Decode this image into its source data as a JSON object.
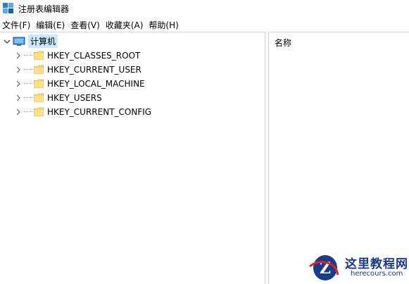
{
  "window": {
    "title": "注册表编辑器",
    "icon": "registry-editor-icon"
  },
  "menu": [
    {
      "label": "文件(F)"
    },
    {
      "label": "编辑(E)"
    },
    {
      "label": "查看(V)"
    },
    {
      "label": "收藏夹(A)"
    },
    {
      "label": "帮助(H)"
    }
  ],
  "tree": {
    "root": {
      "label": "计算机",
      "icon": "computer-icon",
      "expanded": true,
      "selected": true
    },
    "children": [
      {
        "label": "HKEY_CLASSES_ROOT",
        "icon": "folder-icon"
      },
      {
        "label": "HKEY_CURRENT_USER",
        "icon": "folder-icon"
      },
      {
        "label": "HKEY_LOCAL_MACHINE",
        "icon": "folder-icon"
      },
      {
        "label": "HKEY_USERS",
        "icon": "folder-icon"
      },
      {
        "label": "HKEY_CURRENT_CONFIG",
        "icon": "folder-icon"
      }
    ]
  },
  "list": {
    "columns": [
      {
        "label": "名称"
      }
    ]
  },
  "watermark": {
    "cn": "这里教程网",
    "en": "herecours.com"
  },
  "colors": {
    "selection": "#cce8ff",
    "folder": "#f8d775",
    "watermark": "#1a3a8c"
  }
}
